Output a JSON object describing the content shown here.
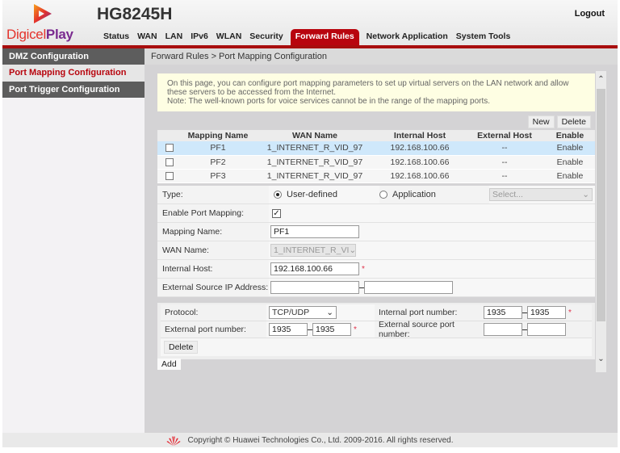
{
  "brand": {
    "logo_word1": "Digicel",
    "logo_word2": "Play",
    "model": "HG8245H"
  },
  "header": {
    "logout_label": "Logout"
  },
  "nav": {
    "items": [
      {
        "label": "Status"
      },
      {
        "label": "WAN"
      },
      {
        "label": "LAN"
      },
      {
        "label": "IPv6"
      },
      {
        "label": "WLAN"
      },
      {
        "label": "Security"
      },
      {
        "label": "Forward Rules",
        "active": true
      },
      {
        "label": "Network Application"
      },
      {
        "label": "System Tools"
      }
    ]
  },
  "sidebar": {
    "items": [
      {
        "label": "DMZ Configuration"
      },
      {
        "label": "Port Mapping Configuration",
        "active": true
      },
      {
        "label": "Port Trigger Configuration"
      }
    ]
  },
  "breadcrumb": "Forward Rules > Port Mapping Configuration",
  "notice": {
    "line1": "On this page, you can configure port mapping parameters to set up virtual servers on the LAN network and allow these servers to be accessed from the Internet.",
    "line2": "Note: The well-known ports for voice services cannot be in the range of the mapping ports."
  },
  "toolbar": {
    "new_label": "New",
    "delete_label": "Delete"
  },
  "table": {
    "columns": [
      "",
      "Mapping Name",
      "WAN Name",
      "Internal Host",
      "External Host",
      "Enable"
    ],
    "rows": [
      {
        "name": "PF1",
        "wan": "1_INTERNET_R_VID_97",
        "internal": "192.168.100.66",
        "external": "--",
        "enable": "Enable",
        "selected": true
      },
      {
        "name": "PF2",
        "wan": "1_INTERNET_R_VID_97",
        "internal": "192.168.100.66",
        "external": "--",
        "enable": "Enable"
      },
      {
        "name": "PF3",
        "wan": "1_INTERNET_R_VID_97",
        "internal": "192.168.100.66",
        "external": "--",
        "enable": "Enable"
      }
    ]
  },
  "form": {
    "type_label": "Type:",
    "type_user_defined": "User-defined",
    "type_application": "Application",
    "application_select_placeholder": "Select...",
    "enable_label": "Enable Port Mapping:",
    "enable_checked": true,
    "mapping_name_label": "Mapping Name:",
    "mapping_name_value": "PF1",
    "wan_name_label": "WAN Name:",
    "wan_name_value": "1_INTERNET_R_VI",
    "internal_host_label": "Internal Host:",
    "internal_host_value": "192.168.100.66",
    "ext_src_ip_label": "External Source IP Address:",
    "ext_src_ip_start": "",
    "ext_src_ip_end": "",
    "required_mark": "*"
  },
  "ports": {
    "protocol_label": "Protocol:",
    "protocol_value": "TCP/UDP",
    "internal_port_label": "Internal port number:",
    "internal_port_start": "1935",
    "internal_port_end": "1935",
    "external_port_label": "External port number:",
    "external_port_start": "1935",
    "external_port_end": "1935",
    "ext_src_port_label": "External source port number:",
    "ext_src_port_start": "",
    "ext_src_port_end": "",
    "delete_label": "Delete",
    "add_label": "Add"
  },
  "footer": {
    "copyright": "Copyright © Huawei Technologies Co., Ltd. 2009-2016. All rights reserved."
  },
  "colors": {
    "brand_red": "#b8050e",
    "sidebar_dark": "#5d5d5d",
    "notice_bg": "#fefee3",
    "selected_row": "#cfe8fb"
  }
}
